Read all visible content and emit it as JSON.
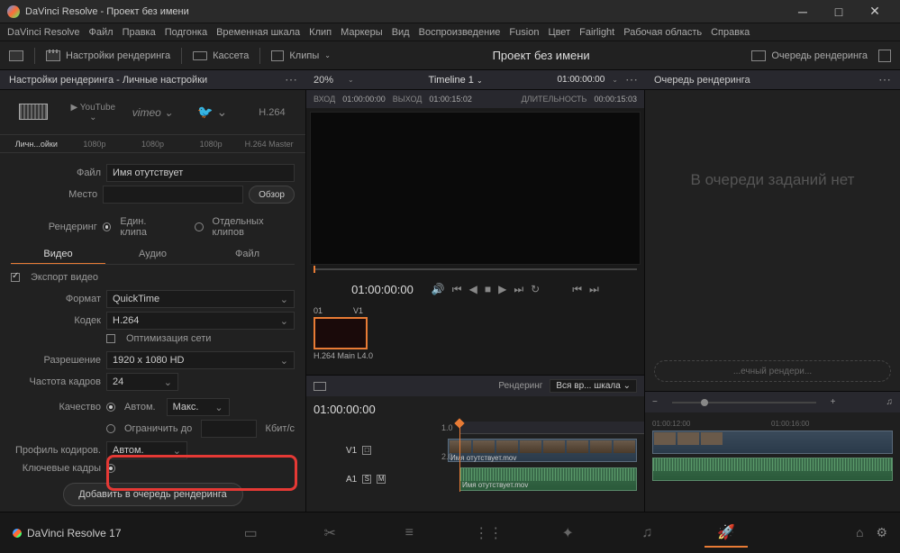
{
  "titlebar": {
    "title": "DaVinci Resolve - Проект без имени"
  },
  "menu": [
    "DaVinci Resolve",
    "Файл",
    "Правка",
    "Подгонка",
    "Временная шкала",
    "Клип",
    "Маркеры",
    "Вид",
    "Воспроизведение",
    "Fusion",
    "Цвет",
    "Fairlight",
    "Рабочая область",
    "Справка"
  ],
  "toolbar": {
    "render_settings": "Настройки рендеринга",
    "tape": "Кассета",
    "clips": "Клипы",
    "project": "Проект без имени",
    "render_queue": "Очередь рендеринга"
  },
  "subhead": {
    "left": "Настройки рендеринга - Личные настройки",
    "pct": "20%",
    "timeline": "Timeline 1",
    "tc": "01:00:00:00",
    "queue": "Очередь рендеринга"
  },
  "tcrow": {
    "in_lbl": "ВХОД",
    "in": "01:00:00:00",
    "out_lbl": "ВЫХОД",
    "out": "01:00:15:02",
    "dur_lbl": "ДЛИТЕЛЬНОСТЬ",
    "dur": "00:00:15:03"
  },
  "presets": {
    "labels": [
      "Личн...ойки",
      "1080p",
      "1080p",
      "1080p",
      "H.264 Master"
    ],
    "names": [
      "Custom",
      "YouTube",
      "vimeo",
      "Twitter",
      "H.264"
    ]
  },
  "settings": {
    "file_lbl": "Файл",
    "file_val": "Имя отутствует",
    "loc_lbl": "Место",
    "browse": "Обзор",
    "rendering_lbl": "Рендеринг",
    "single": "Един. клипа",
    "multi": "Отдельных клипов",
    "tabs": [
      "Видео",
      "Аудио",
      "Файл"
    ],
    "export": "Экспорт видео",
    "format_lbl": "Формат",
    "format": "QuickTime",
    "codec_lbl": "Кодек",
    "codec": "H.264",
    "netopt": "Оптимизация сети",
    "res_lbl": "Разрешение",
    "res": "1920 x 1080 HD",
    "fps_lbl": "Частота кадров",
    "fps": "24",
    "quality_lbl": "Качество",
    "auto": "Автом.",
    "max": "Макс.",
    "limit": "Ограничить до",
    "kbps": "Кбит/с",
    "profile_lbl": "Профиль кодиров.",
    "profile": "Автом.",
    "keyframes_lbl": "Ключевые кадры",
    "add_to_queue": "Добавить в очередь рендеринга"
  },
  "transport": {
    "tc": "01:00:00:00"
  },
  "thumb": {
    "num": "01",
    "track": "V1",
    "codec": "H.264 Main L4.0"
  },
  "tlctrl": {
    "rendering": "Рендеринг",
    "range": "Вся вр... шкала"
  },
  "timeline": {
    "tc": "01:00:00:00",
    "v1": "V1",
    "a1": "A1",
    "num1": "1.0",
    "num2": "2.0",
    "clipname": "Имя отутствует.mov"
  },
  "queue": {
    "empty": "В очереди заданий нет",
    "start": "...ечный рендери..."
  },
  "footer": {
    "brand": "DaVinci Resolve 17"
  }
}
